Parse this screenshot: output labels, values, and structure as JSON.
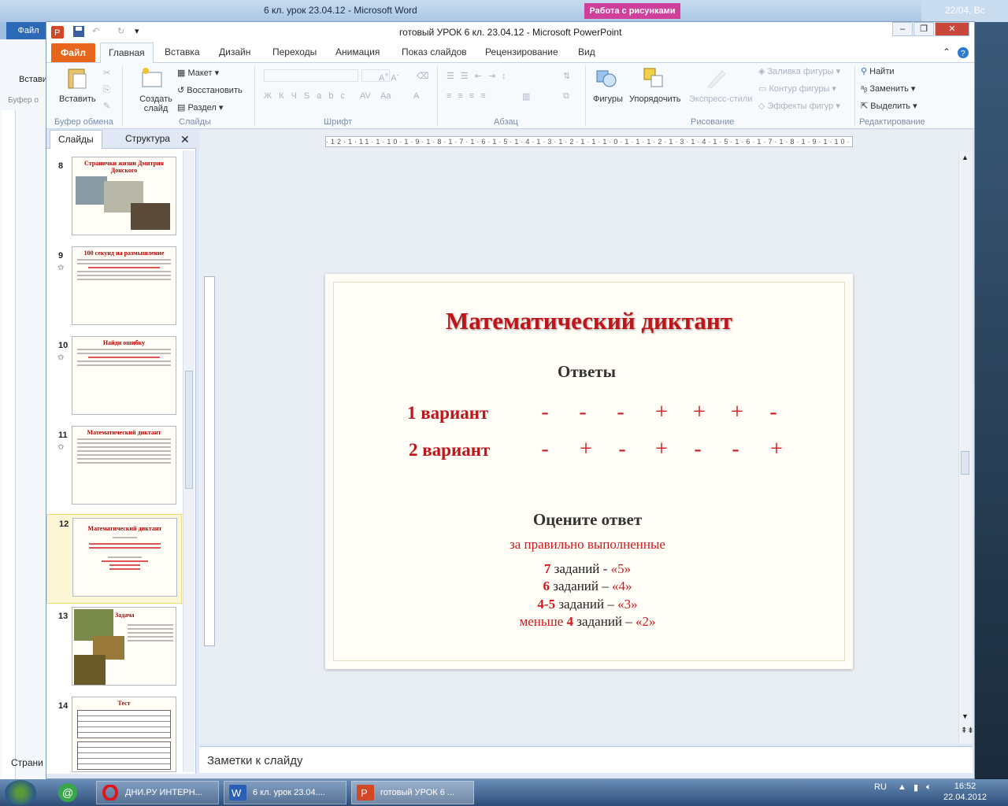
{
  "word_window": {
    "title": "6 кл.  урок 23.04.12  -  Microsoft Word",
    "context_tab": "Работа с рисунками",
    "file_tab": "Файл",
    "paste_label": "Вставить",
    "clipboard_label": "Буфер о",
    "pages_label": "Страни",
    "clock_text": "22/04, Вс"
  },
  "ppt_window": {
    "title": "готовый УРОК  6 кл. 23.04.12  -  Microsoft PowerPoint",
    "file_tab": "Файл",
    "tabs": [
      "Главная",
      "Вставка",
      "Дизайн",
      "Переходы",
      "Анимация",
      "Показ слайдов",
      "Рецензирование",
      "Вид"
    ],
    "active_tab": "Главная"
  },
  "ribbon": {
    "paste": "Вставить",
    "create_slide": "Создать слайд",
    "layout": "Макет",
    "reset": "Восстановить",
    "section": "Раздел",
    "shapes": "Фигуры",
    "arrange": "Упорядочить",
    "express_styles": "Экспресс-стили",
    "shape_fill": "Заливка фигуры",
    "shape_outline": "Контур фигуры",
    "shape_effects": "Эффекты фигур",
    "find": "Найти",
    "replace": "Заменить",
    "select": "Выделить",
    "groups": {
      "clipboard": "Буфер обмена",
      "slides": "Слайды",
      "font": "Шрифт",
      "paragraph": "Абзац",
      "drawing": "Рисование",
      "editing": "Редактирование"
    }
  },
  "panel": {
    "tab_slides": "Слайды",
    "tab_outline": "Структура",
    "thumbnails": [
      {
        "num": "8",
        "title": "Странички жизни Дмитрия Донского"
      },
      {
        "num": "9",
        "title": "100 секунд на размышление"
      },
      {
        "num": "10",
        "title": "Найди ошибку"
      },
      {
        "num": "11",
        "title": "Математический диктант"
      },
      {
        "num": "12",
        "title": "Математический диктант"
      },
      {
        "num": "13",
        "title": "Задача"
      },
      {
        "num": "14",
        "title": "Тест"
      }
    ]
  },
  "slide": {
    "title": "Математический  диктант",
    "answers_heading": "Ответы",
    "variant1_label": "1  вариант",
    "variant1_marks": [
      "-",
      "-",
      "-",
      "+",
      "+",
      "+",
      "-"
    ],
    "variant2_label": "2  вариант",
    "variant2_marks": [
      "-",
      "+",
      "-",
      "+",
      "-",
      "-",
      "+"
    ],
    "rate_heading": "Оцените ответ",
    "rate_intro": "за правильно выполненные",
    "grades": [
      {
        "count": "7",
        "text": " заданий  -  ",
        "grade": "«5»"
      },
      {
        "count": "6",
        "text": " заданий – ",
        "grade": "«4»"
      },
      {
        "count": "4-5",
        "text": " заданий – ",
        "grade": "«3»"
      },
      {
        "prefix": "меньше ",
        "count": "4",
        "text": " заданий – ",
        "grade": "«2»"
      }
    ]
  },
  "notes_placeholder": "Заметки к слайду",
  "taskbar": {
    "items": [
      "ДНИ.РУ ИНТЕРН...",
      "6 кл.  урок 23.04....",
      "готовый УРОК  6 ..."
    ],
    "lang": "RU",
    "time": "16:52",
    "date": "22.04.2012"
  }
}
